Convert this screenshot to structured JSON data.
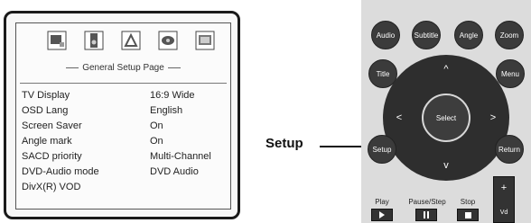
{
  "osd": {
    "icons": [
      "general-setup-icon",
      "speaker-setup-icon",
      "audio-setup-icon",
      "video-setup-icon",
      "preference-icon"
    ],
    "page_title": "General Setup Page",
    "settings": [
      {
        "label": "TV Display",
        "value": "16:9 Wide"
      },
      {
        "label": "OSD Lang",
        "value": "English"
      },
      {
        "label": "Screen Saver",
        "value": "On"
      },
      {
        "label": "Angle mark",
        "value": "On"
      },
      {
        "label": "SACD priority",
        "value": "Multi-Channel"
      },
      {
        "label": "DVD-Audio mode",
        "value": "DVD Audio"
      },
      {
        "label": "DivX(R) VOD",
        "value": ""
      }
    ]
  },
  "callout": {
    "label": "Setup"
  },
  "remote": {
    "audio": "Audio",
    "subtitle": "Subtitle",
    "angle": "Angle",
    "zoom": "Zoom",
    "title": "Title",
    "menu": "Menu",
    "select": "Select",
    "setup": "Setup",
    "return": "Return",
    "arrow_up": "^",
    "arrow_down": "v",
    "arrow_left": "<",
    "arrow_right": ">",
    "play": "Play",
    "pause_step": "Pause/Step",
    "stop": "Stop",
    "vol_plus": "+",
    "vol_label": "Vd"
  },
  "colors": {
    "remote_body": "#dcdcdc",
    "button": "#3b3b3b",
    "osd_border": "#1a1a1a"
  }
}
